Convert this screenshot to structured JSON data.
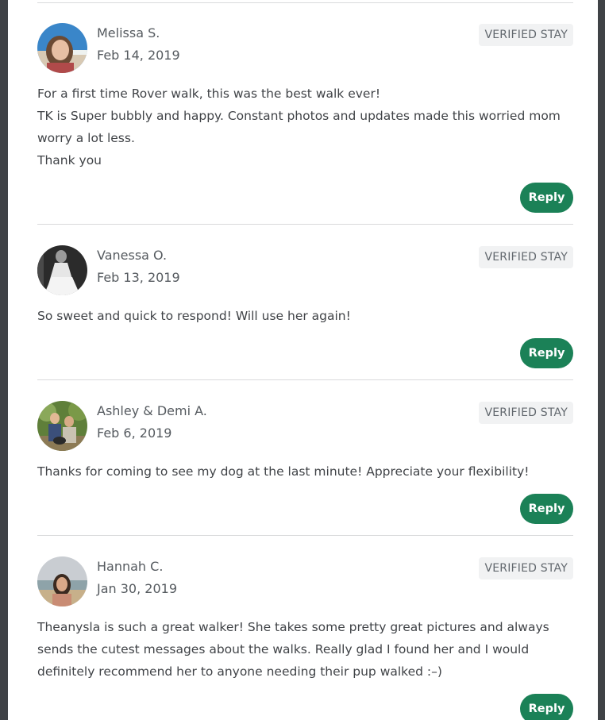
{
  "reviews": [
    {
      "name": "Melissa S.",
      "date": "Feb 14, 2019",
      "badge": "VERIFIED STAY",
      "lines": [
        "For a first time Rover walk, this was the best walk ever!",
        "TK is Super bubbly and happy. Constant photos and updates made this worried mom",
        "worry a lot less.",
        "Thank you"
      ],
      "reply_label": "Reply"
    },
    {
      "name": "Vanessa O.",
      "date": "Feb 13, 2019",
      "badge": "VERIFIED STAY",
      "lines": [
        "So sweet and quick to respond! Will use her again!"
      ],
      "reply_label": "Reply"
    },
    {
      "name": "Ashley & Demi A.",
      "date": "Feb 6, 2019",
      "badge": "VERIFIED STAY",
      "lines": [
        "Thanks for coming to see my dog at the last minute! Appreciate your flexibility!"
      ],
      "reply_label": "Reply"
    },
    {
      "name": "Hannah C.",
      "date": "Jan 30, 2019",
      "badge": "VERIFIED STAY",
      "lines": [
        "Theanysla is such a great walker! She takes some pretty great pictures and always",
        "sends the cutest messages about the walks. Really glad I found her and I would",
        "definitely recommend her to anyone needing their pup walked :–)"
      ],
      "reply_label": "Reply"
    }
  ],
  "colors": {
    "reply_button": "#1b8157",
    "badge_bg": "#f1f2f3",
    "page_bg": "#404347"
  }
}
